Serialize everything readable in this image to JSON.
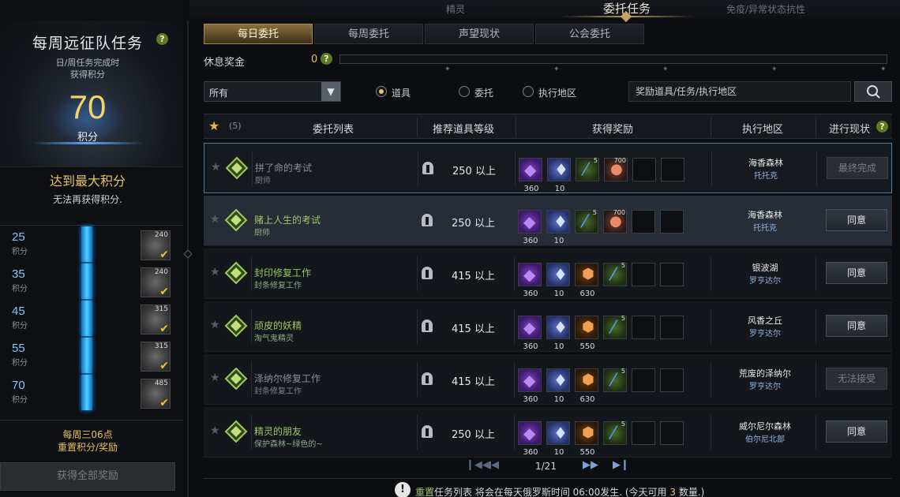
{
  "topmenu": {
    "left": "精灵",
    "center": "委托任务",
    "right": "免疫/异常状态抗性"
  },
  "left_panel": {
    "title": "每周远征队任务",
    "subtitle_line1": "日/周任务完成时",
    "subtitle_line2": "获得积分",
    "points": "70",
    "points_unit": "积分",
    "max_title": "达到最大积分",
    "max_sub": "无法再获得积分.",
    "milestones": [
      {
        "value": "25",
        "unit": "积分",
        "reward_count": "240",
        "claimed": true
      },
      {
        "value": "35",
        "unit": "积分",
        "reward_count": "240",
        "claimed": true
      },
      {
        "value": "45",
        "unit": "积分",
        "reward_count": "315",
        "claimed": true
      },
      {
        "value": "55",
        "unit": "积分",
        "reward_count": "315",
        "claimed": true
      },
      {
        "value": "70",
        "unit": "积分",
        "reward_count": "485",
        "claimed": true
      }
    ],
    "reset_line1": "每周三06点",
    "reset_line2": "重置积分/奖励",
    "claim_all": "获得全部奖励"
  },
  "tabs": [
    {
      "label": "每日委托",
      "active": true
    },
    {
      "label": "每周委托",
      "active": false
    },
    {
      "label": "声望现状",
      "active": false
    },
    {
      "label": "公会委托",
      "active": false
    }
  ],
  "rest_bonus": {
    "label": "休息奖金",
    "value": "0"
  },
  "filter": {
    "select_value": "所有",
    "radios": [
      {
        "label": "道具",
        "checked": true
      },
      {
        "label": "委托",
        "checked": false
      },
      {
        "label": "执行地区",
        "checked": false
      }
    ],
    "search_placeholder": "奖励道具/任务/执行地区"
  },
  "table": {
    "fav_count": "(5)",
    "headers": {
      "list": "委托列表",
      "level": "推荐道具等级",
      "reward": "获得奖励",
      "area": "执行地区",
      "status": "进行现状"
    },
    "rows": [
      {
        "name": "拼了命的考试",
        "sub": "厨师",
        "level": "250 以上",
        "rewards": [
          {
            "type": "exp",
            "count": "360"
          },
          {
            "type": "dia",
            "count": "10"
          },
          {
            "type": "pot",
            "sup": "5"
          },
          {
            "type": "heart",
            "sup": "700"
          }
        ],
        "area": "海香森林",
        "area2": "托托克",
        "status": "最终完成",
        "status_enabled": false,
        "dim": true
      },
      {
        "name": "赌上人生的考试",
        "sub": "厨师",
        "level": "250 以上",
        "rewards": [
          {
            "type": "exp",
            "count": "360"
          },
          {
            "type": "dia",
            "count": "10"
          },
          {
            "type": "pot",
            "sup": "5"
          },
          {
            "type": "heart",
            "sup": "700"
          }
        ],
        "area": "海香森林",
        "area2": "托托克",
        "status": "同意",
        "status_enabled": true,
        "dim": false
      },
      {
        "name": "封印修复工作",
        "sub": "封条修复工作",
        "level": "415 以上",
        "rewards": [
          {
            "type": "exp",
            "count": "360"
          },
          {
            "type": "dia",
            "count": "10"
          },
          {
            "type": "gem",
            "count": "630"
          },
          {
            "type": "pot",
            "sup": "5"
          }
        ],
        "area": "银波湖",
        "area2": "罗亨达尔",
        "status": "同意",
        "status_enabled": true,
        "dim": false
      },
      {
        "name": "顽皮的妖精",
        "sub": "淘气鬼精灵",
        "level": "415 以上",
        "rewards": [
          {
            "type": "exp",
            "count": "360"
          },
          {
            "type": "dia",
            "count": "10"
          },
          {
            "type": "gem",
            "count": "550"
          },
          {
            "type": "pot",
            "sup": "5"
          }
        ],
        "area": "风香之丘",
        "area2": "罗亨达尔",
        "status": "同意",
        "status_enabled": true,
        "dim": false
      },
      {
        "name": "泽纳尔修复工作",
        "sub": "封条修复工作",
        "level": "415 以上",
        "rewards": [
          {
            "type": "exp",
            "count": "360"
          },
          {
            "type": "dia",
            "count": "10"
          },
          {
            "type": "gem",
            "count": "630"
          },
          {
            "type": "pot",
            "sup": "5"
          }
        ],
        "area": "荒废的泽纳尔",
        "area2": "罗亨达尔",
        "status": "无法接受",
        "status_enabled": false,
        "dim": true
      },
      {
        "name": "精灵的朋友",
        "sub": "保护森林~绿色的~",
        "level": "250 以上",
        "rewards": [
          {
            "type": "exp",
            "count": "360"
          },
          {
            "type": "dia",
            "count": "10"
          },
          {
            "type": "gem",
            "count": "550"
          },
          {
            "type": "pot",
            "sup": "5"
          }
        ],
        "area": "威尔尼尔森林",
        "area2": "伯尔尼北部",
        "status": "同意",
        "status_enabled": true,
        "dim": false
      }
    ]
  },
  "pager": {
    "text": "1/21"
  },
  "footer": {
    "p1": "重置",
    "p2": "任务列表 将会在每天俄罗斯时间 06:00发生. (今天可用 ",
    "p3": "3",
    "p4": " 数量.)"
  },
  "colors": {
    "accent_gold": "#e8c35a",
    "accent_blue": "#4fd0ff",
    "name_green": "#9bc86a"
  }
}
